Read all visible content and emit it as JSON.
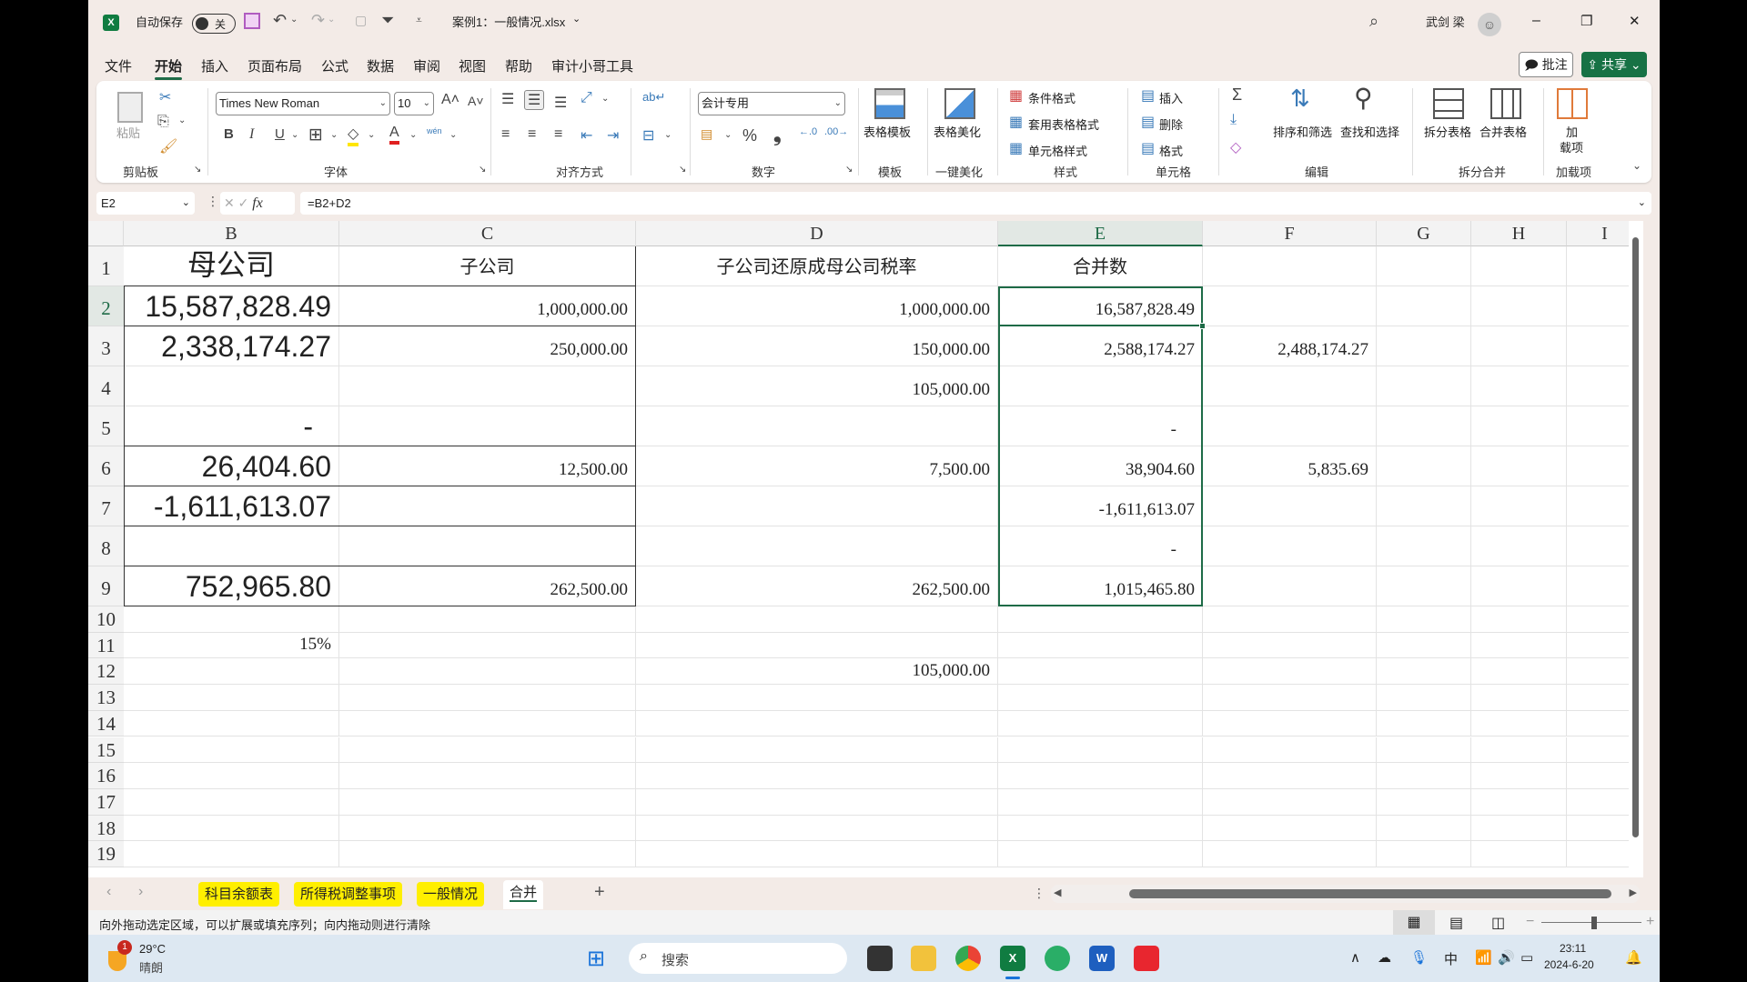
{
  "titlebar": {
    "app_icon": "excel-icon",
    "autosave_label": "自动保存",
    "autosave_state": "关",
    "doc_title": "案例1：一般情况.xlsx",
    "user_name": "武剑 梁",
    "minimize": "–",
    "restore": "❐",
    "close": "✕"
  },
  "menu": {
    "tabs": [
      "文件",
      "开始",
      "插入",
      "页面布局",
      "公式",
      "数据",
      "审阅",
      "视图",
      "帮助",
      "审计小哥工具"
    ],
    "active": "开始",
    "comment_btn": "批注",
    "share_btn": "共享"
  },
  "ribbon": {
    "clipboard": {
      "paste": "粘贴",
      "label": "剪贴板"
    },
    "font": {
      "name": "Times New Roman",
      "size": "10",
      "bold": "B",
      "italic": "I",
      "underline": "U",
      "phonetic": "wén",
      "label": "字体"
    },
    "alignment": {
      "label": "对齐方式"
    },
    "number": {
      "format": "会计专用",
      "percent": "%",
      "comma": "❟",
      "label": "数字"
    },
    "template": {
      "btn": "表格模板",
      "label": "模板"
    },
    "beautify": {
      "btn": "表格美化",
      "label": "一键美化"
    },
    "styles": {
      "conditional": "条件格式",
      "table_format": "套用表格格式",
      "cell_styles": "单元格样式",
      "label": "样式"
    },
    "cells": {
      "insert": "插入",
      "delete": "删除",
      "format": "格式",
      "label": "单元格"
    },
    "editing": {
      "sum": "Σ",
      "sort_filter": "排序和筛选",
      "find_select": "查找和选择",
      "label": "编辑"
    },
    "split_merge": {
      "split": "拆分表格",
      "merge": "合并表格",
      "label": "拆分合并"
    },
    "addins": {
      "btn_line1": "加",
      "btn_line2": "载项",
      "label": "加载项"
    }
  },
  "formula_bar": {
    "name_box": "E2",
    "fx": "fx",
    "formula": "=B2+D2"
  },
  "sheet": {
    "columns": [
      "B",
      "C",
      "D",
      "E",
      "F",
      "G",
      "H",
      "I"
    ],
    "selected_column": "E",
    "rows": [
      "1",
      "2",
      "3",
      "4",
      "5",
      "6",
      "7",
      "8",
      "9",
      "10",
      "11",
      "12",
      "13",
      "14",
      "15",
      "16",
      "17",
      "18",
      "19"
    ],
    "selected_row": "2",
    "cells": {
      "B1": "母公司",
      "C1": "子公司",
      "D1": "子公司还原成母公司税率",
      "E1": "合并数",
      "B2": "15,587,828.49",
      "C2": "1,000,000.00",
      "D2": "1,000,000.00",
      "E2": "16,587,828.49",
      "B3": "2,338,174.27",
      "C3": "250,000.00",
      "D3": "150,000.00",
      "E3": "2,588,174.27",
      "F3": "2,488,174.27",
      "D4": "105,000.00",
      "B5": "-",
      "E5": "-",
      "B6": "26,404.60",
      "C6": "12,500.00",
      "D6": "7,500.00",
      "E6": "38,904.60",
      "F6": "5,835.69",
      "B7": "-1,611,613.07",
      "E7": "-1,611,613.07",
      "E8": "-",
      "B9": "752,965.80",
      "C9": "262,500.00",
      "D9": "262,500.00",
      "E9": "1,015,465.80",
      "B11": "15%",
      "D12": "105,000.00"
    }
  },
  "sheet_tabs": {
    "tabs": [
      "科目余额表",
      "所得税调整事项",
      "一般情况",
      "合并"
    ],
    "active": "合并",
    "highlight_color": "#ffef00",
    "add": "+"
  },
  "status_bar": {
    "message": "向外拖动选定区域，可以扩展或填充序列；向内拖动则进行清除"
  },
  "taskbar": {
    "weather_temp": "29°C",
    "weather_desc": "晴朗",
    "weather_badge": "1",
    "search_placeholder": "搜索",
    "ime": "中",
    "time": "23:11",
    "date": "2024-6-20"
  },
  "colors": {
    "accent": "#1e6b47",
    "share": "#177245",
    "tab_highlight": "#ffef00"
  }
}
